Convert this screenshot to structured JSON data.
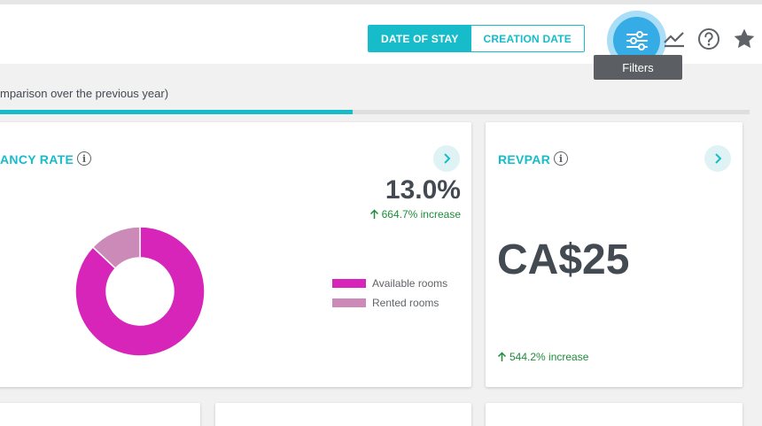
{
  "header": {
    "toggle": {
      "date_of_stay": "DATE OF STAY",
      "creation_date": "CREATION DATE"
    },
    "filter_tooltip": "Filters",
    "icons": [
      "filter-sliders-icon",
      "trend-chart-icon",
      "help-circle-icon",
      "star-icon"
    ]
  },
  "comparison_note": "mparison over the previous year)",
  "progress": {
    "fill_fraction": 0.47
  },
  "occupancy_card": {
    "title": "ANCY RATE",
    "value": "13.0%",
    "change_text": "664.7% increase",
    "legend": {
      "available": "Available rooms",
      "rented": "Rented rooms"
    }
  },
  "revpar_card": {
    "title": "REVPAR",
    "value": "CA$25",
    "change_text": "544.2% increase"
  },
  "colors": {
    "accent": "#17bccb",
    "available": "#d625b8",
    "rented": "#cb8ab7",
    "increase": "#1e8c3a"
  },
  "chart_data": {
    "type": "pie",
    "categories": [
      "Available rooms",
      "Rented rooms"
    ],
    "values": [
      87.0,
      13.0
    ],
    "title": "",
    "legend": "right",
    "donut": true
  }
}
